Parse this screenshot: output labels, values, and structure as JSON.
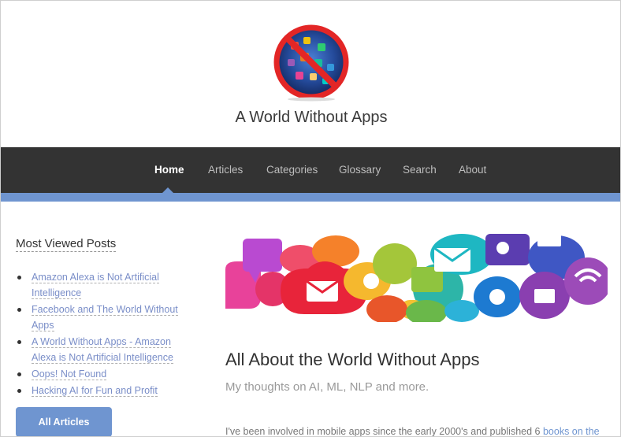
{
  "site": {
    "title": "A World Without Apps"
  },
  "nav": {
    "items": [
      {
        "label": "Home",
        "active": true
      },
      {
        "label": "Articles",
        "active": false
      },
      {
        "label": "Categories",
        "active": false
      },
      {
        "label": "Glossary",
        "active": false
      },
      {
        "label": "Search",
        "active": false
      },
      {
        "label": "About",
        "active": false
      }
    ]
  },
  "sidebar": {
    "widget_title": "Most Viewed Posts",
    "posts": [
      {
        "lines": [
          "Amazon Alexa is Not Artificial",
          "Intelligence"
        ]
      },
      {
        "lines": [
          "Facebook and The World Without",
          "Apps"
        ]
      },
      {
        "lines": [
          "A World Without Apps - Amazon",
          "Alexa is Not Artificial Intelligence"
        ]
      },
      {
        "lines": [
          "Oops! Not Found"
        ]
      },
      {
        "lines": [
          "Hacking AI for Fun and Profit"
        ]
      }
    ],
    "all_articles_label": "All Articles"
  },
  "main": {
    "heading": "All About the World Without Apps",
    "subheading": "My thoughts on AI, ML, NLP and more.",
    "paragraph_text": "I've been involved in mobile apps since the early 2000's and published 6 ",
    "paragraph_link": "books on the"
  },
  "colors": {
    "accent": "#6f95d0",
    "nav_bg": "#333333",
    "link": "#7a8ec8"
  }
}
